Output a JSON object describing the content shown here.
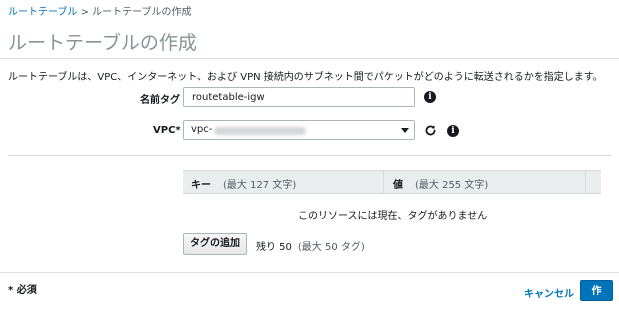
{
  "breadcrumb": {
    "parent": "ルートテーブル",
    "separator": " > ",
    "current": "ルートテーブルの作成"
  },
  "page": {
    "title": "ルートテーブルの作成",
    "description": "ルートテーブルは、VPC、インターネット、および VPN 接続内のサブネット間でパケットがどのように転送されるかを指定します。"
  },
  "form": {
    "name_tag_label": "名前タグ",
    "name_tag_value": "routetable-igw",
    "vpc_label": "VPC*",
    "vpc_value_prefix": "vpc-"
  },
  "tags": {
    "key_header": "キー",
    "key_hint": "(最大 127 文字)",
    "value_header": "値",
    "value_hint": "(最大 255 文字)",
    "empty_message": "このリソースには現在、タグがありません",
    "add_button": "タグの追加",
    "remaining_label": "残り 50",
    "remaining_hint": "(最大 50 タグ)"
  },
  "footer": {
    "required_note": "* 必須",
    "cancel": "キャンセル",
    "create": "作成"
  },
  "colors": {
    "link": "#0073bb",
    "primary_button": "#0073bb"
  }
}
